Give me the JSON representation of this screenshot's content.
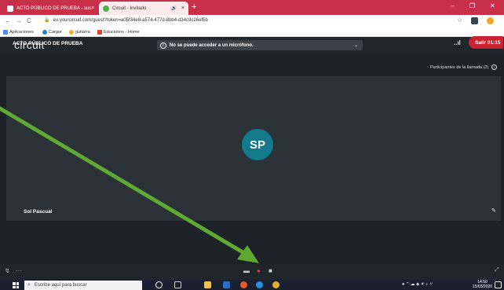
{
  "browser": {
    "tabs": [
      {
        "label": "ACTO PÚBLICO DE PRUEBA - sus",
        "close": "×"
      },
      {
        "label": "Circuit - Invitado",
        "close": "×",
        "audio": "🔊"
      }
    ],
    "new_tab": "+",
    "window_controls": {
      "minimize": "–",
      "maximize": "❐",
      "close": "✕"
    },
    "nav": {
      "back": "←",
      "forward": "→",
      "reload": "C"
    },
    "url": "eu.yourcircuit.com/guest?token=a05f34e8-a574-477d-8bb4-d34c9c26ef5b",
    "bookmarks": [
      "Aplicaciones",
      "Cargar",
      "guitarra",
      "Educamos - Home"
    ]
  },
  "app": {
    "logo": "circuit",
    "warning": "No se puede acceder a un micrófono.",
    "call_title": "ACTO PÚBLICO DE PRUEBA",
    "signal": "..ıl",
    "leave_button": "Salir 01:15",
    "participants": "Participantes de la llamada (2)",
    "avatar_initials": "SP",
    "participant_name": "Sol Pascual",
    "controls": [
      "screen-share-icon",
      "mic-muted-icon",
      "video-icon"
    ]
  },
  "taskbar": {
    "search_placeholder": "Escribe aquí para buscar",
    "time": "14:50",
    "date": "15/03/2020"
  },
  "colors": {
    "tab_bar": "#c8304a",
    "app_bg": "#1c2228",
    "avatar": "#127a8a",
    "leave": "#c92231",
    "arrow": "#5fa832"
  }
}
